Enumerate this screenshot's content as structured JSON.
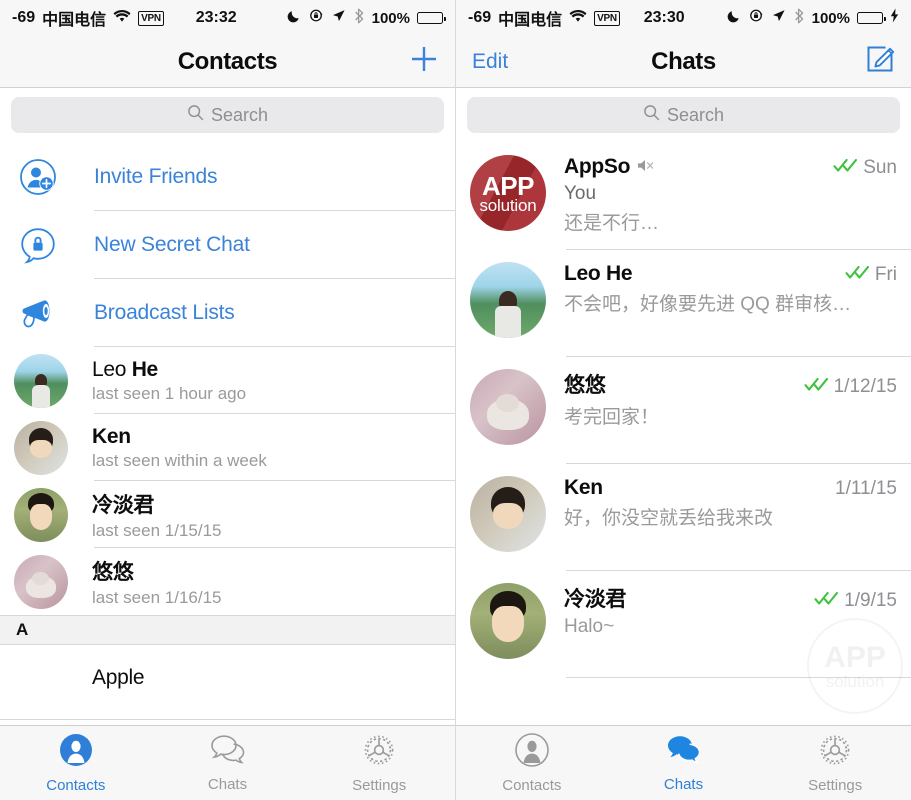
{
  "left": {
    "status": {
      "signal": "-69",
      "carrier": "中国电信",
      "wifi_icon": "wifi-icon",
      "vpn": "VPN",
      "time": "23:32",
      "moon_icon": "moon-icon",
      "lock_rotation_icon": "rotation-lock-icon",
      "location_icon": "location-arrow-icon",
      "bluetooth_icon": "bluetooth-icon",
      "battery_percent": "100%",
      "battery_state": "full",
      "battery_color": "#111111"
    },
    "nav": {
      "title": "Contacts",
      "right_action": "add-button"
    },
    "search": {
      "placeholder": "Search",
      "icon": "search-icon"
    },
    "actions": [
      {
        "label": "Invite Friends",
        "icon": "add-person-icon"
      },
      {
        "label": "New Secret Chat",
        "icon": "lock-bubble-icon"
      },
      {
        "label": "Broadcast Lists",
        "icon": "megaphone-icon"
      }
    ],
    "contacts": [
      {
        "first": "Leo ",
        "last": "He",
        "status": "last seen 1 hour ago",
        "avatar": "av-leo"
      },
      {
        "first": "Ken",
        "last": "",
        "status": "last seen within a week",
        "avatar": "av-ken"
      },
      {
        "first": "冷淡君",
        "last": "",
        "status": "last seen 1/15/15",
        "avatar": "av-leng"
      },
      {
        "first": "悠悠",
        "last": "",
        "status": "last seen 1/16/15",
        "avatar": "av-you"
      }
    ],
    "section_header": "A",
    "section_rows": [
      {
        "name": "Apple"
      }
    ],
    "tabs": [
      {
        "label": "Contacts",
        "icon": "person-icon",
        "active": true
      },
      {
        "label": "Chats",
        "icon": "chat-bubbles-icon",
        "active": false
      },
      {
        "label": "Settings",
        "icon": "gear-icon",
        "active": false
      }
    ]
  },
  "right": {
    "status": {
      "signal": "-69",
      "carrier": "中国电信",
      "wifi_icon": "wifi-icon",
      "vpn": "VPN",
      "time": "23:30",
      "moon_icon": "moon-icon",
      "lock_rotation_icon": "rotation-lock-icon",
      "location_icon": "location-arrow-icon",
      "bluetooth_icon": "bluetooth-icon",
      "battery_percent": "100%",
      "battery_state": "charging",
      "battery_color": "#49d860"
    },
    "nav": {
      "left_action": "Edit",
      "title": "Chats",
      "right_action": "compose-button"
    },
    "search": {
      "placeholder": "Search",
      "icon": "search-icon"
    },
    "chats": [
      {
        "name": "AppSo",
        "muted": true,
        "sender": "You",
        "preview": "还是不行…",
        "time": "Sun",
        "read_status": "double-check",
        "avatar": "av-appso",
        "avatar_text_1": "APP",
        "avatar_text_2": "solution"
      },
      {
        "name": "Leo He",
        "muted": false,
        "sender": "",
        "preview": "不会吧，好像要先进 QQ 群审核…",
        "time": "Fri",
        "read_status": "double-check",
        "avatar": "av-leo"
      },
      {
        "name": "悠悠",
        "muted": false,
        "sender": "",
        "preview": "考完回家！",
        "time": "1/12/15",
        "read_status": "double-check",
        "avatar": "av-you"
      },
      {
        "name": "Ken",
        "muted": false,
        "sender": "",
        "preview": "好，你没空就丢给我来改",
        "time": "1/11/15",
        "read_status": "none",
        "avatar": "av-ken"
      },
      {
        "name": "冷淡君",
        "muted": false,
        "sender": "",
        "preview": "Halo~",
        "time": "1/9/15",
        "read_status": "double-check",
        "avatar": "av-leng"
      }
    ],
    "watermark": {
      "line1": "APP",
      "line2": "solution"
    },
    "tabs": [
      {
        "label": "Contacts",
        "icon": "person-icon",
        "active": false
      },
      {
        "label": "Chats",
        "icon": "chat-bubbles-icon",
        "active": true
      },
      {
        "label": "Settings",
        "icon": "gear-icon",
        "active": false
      }
    ]
  },
  "colors": {
    "accent": "#2f7fd8",
    "link": "#3b83d8",
    "check": "#3cc23c",
    "appso_red": "#a82a30"
  }
}
